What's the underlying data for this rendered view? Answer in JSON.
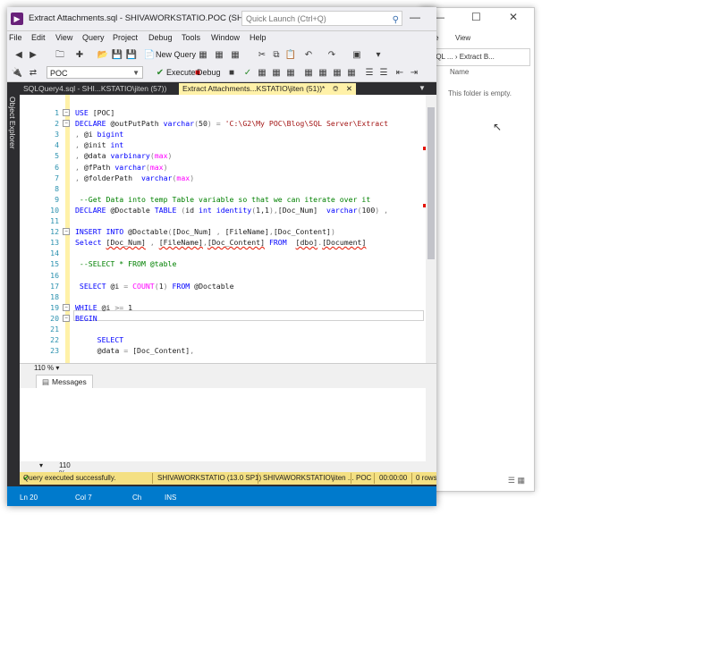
{
  "ssms": {
    "window_title": "Extract Attachments.sql - SHIVAWORKSTATIO.POC (SHIVAWORK...",
    "quick_launch_placeholder": "Quick Launch (Ctrl+Q)",
    "menu": [
      "File",
      "Edit",
      "View",
      "Query",
      "Project",
      "Debug",
      "Tools",
      "Window",
      "Help"
    ],
    "toolbar": {
      "new_query": "New Query",
      "database": "POC",
      "execute": "Execute",
      "debug": "Debug"
    },
    "tabs": {
      "inactive": "SQLQuery4.sql - SHI...KSTATIO\\jiten (57))",
      "active": "Extract Attachments...KSTATIO\\jiten (51))*"
    },
    "object_explorer": "Object Explorer",
    "editor_lines": [
      {
        "n": "1",
        "tokens": [
          [
            "kw",
            "USE "
          ],
          [
            "id",
            "[POC]"
          ]
        ],
        "fold": true
      },
      {
        "n": "2",
        "tokens": [
          [
            "kw",
            "DECLARE "
          ],
          [
            "id",
            "@outPutPath "
          ],
          [
            "kw",
            "varchar"
          ],
          [
            "gr",
            "("
          ],
          [
            "id",
            "50"
          ],
          [
            "gr",
            ") = "
          ],
          [
            "str",
            "'C:\\G2\\My POC\\Blog\\SQL Server\\Extract"
          ]
        ],
        "fold": true
      },
      {
        "n": "3",
        "tokens": [
          [
            "gr",
            ", "
          ],
          [
            "id",
            "@i "
          ],
          [
            "kw",
            "bigint"
          ]
        ]
      },
      {
        "n": "4",
        "tokens": [
          [
            "gr",
            ", "
          ],
          [
            "id",
            "@init "
          ],
          [
            "kw",
            "int"
          ]
        ]
      },
      {
        "n": "5",
        "tokens": [
          [
            "gr",
            ", "
          ],
          [
            "id",
            "@data "
          ],
          [
            "kw",
            "varbinary"
          ],
          [
            "gr",
            "("
          ],
          [
            "fn",
            "max"
          ],
          [
            "gr",
            ")"
          ]
        ]
      },
      {
        "n": "6",
        "tokens": [
          [
            "gr",
            ", "
          ],
          [
            "id",
            "@fPath "
          ],
          [
            "kw",
            "varchar"
          ],
          [
            "gr",
            "("
          ],
          [
            "fn",
            "max"
          ],
          [
            "gr",
            ")"
          ]
        ]
      },
      {
        "n": "7",
        "tokens": [
          [
            "gr",
            ", "
          ],
          [
            "id",
            "@folderPath  "
          ],
          [
            "kw",
            "varchar"
          ],
          [
            "gr",
            "("
          ],
          [
            "fn",
            "max"
          ],
          [
            "gr",
            ")"
          ]
        ]
      },
      {
        "n": "8",
        "tokens": []
      },
      {
        "n": "9",
        "tokens": [
          [
            "cm",
            " --Get Data into temp Table variable so that we can iterate over it"
          ]
        ]
      },
      {
        "n": "10",
        "tokens": [
          [
            "kw",
            "DECLARE "
          ],
          [
            "id",
            "@Doctable "
          ],
          [
            "kw",
            "TABLE "
          ],
          [
            "gr",
            "("
          ],
          [
            "id",
            "id "
          ],
          [
            "kw",
            "int identity"
          ],
          [
            "gr",
            "("
          ],
          [
            "id",
            "1,1"
          ],
          [
            "gr",
            "),"
          ],
          [
            "id",
            "[Doc_Num]  "
          ],
          [
            "kw",
            "varchar"
          ],
          [
            "gr",
            "("
          ],
          [
            "id",
            "100"
          ],
          [
            "gr",
            ") ,"
          ]
        ]
      },
      {
        "n": "11",
        "tokens": []
      },
      {
        "n": "12",
        "tokens": [
          [
            "kw",
            "INSERT INTO "
          ],
          [
            "id",
            "@Doctable"
          ],
          [
            "gr",
            "("
          ],
          [
            "id",
            "[Doc_Num] "
          ],
          [
            "gr",
            ", "
          ],
          [
            "id",
            "[FileName]"
          ],
          [
            "gr",
            ","
          ],
          [
            "id",
            "[Doc_Content]"
          ],
          [
            "gr",
            ")"
          ]
        ],
        "fold": true
      },
      {
        "n": "13",
        "tokens": [
          [
            "kw",
            "Select "
          ],
          [
            "sqid",
            "[Doc_Num]"
          ],
          [
            "gr",
            " , "
          ],
          [
            "sqid",
            "[FileName]"
          ],
          [
            "gr",
            ","
          ],
          [
            "sqid",
            "[Doc_Content]"
          ],
          [
            "kw",
            " FROM  "
          ],
          [
            "sqid",
            "[dbo]"
          ],
          [
            "gr",
            "."
          ],
          [
            "sqid",
            "[Document]"
          ]
        ]
      },
      {
        "n": "14",
        "tokens": []
      },
      {
        "n": "15",
        "tokens": [
          [
            "cm",
            " --SELECT * FROM @table"
          ]
        ]
      },
      {
        "n": "16",
        "tokens": []
      },
      {
        "n": "17",
        "tokens": [
          [
            "kw",
            " SELECT "
          ],
          [
            "id",
            "@i "
          ],
          [
            "gr",
            "= "
          ],
          [
            "fn",
            "COUNT"
          ],
          [
            "gr",
            "("
          ],
          [
            "id",
            "1"
          ],
          [
            "gr",
            ") "
          ],
          [
            "kw",
            "FROM "
          ],
          [
            "id",
            "@Doctable"
          ]
        ]
      },
      {
        "n": "18",
        "tokens": []
      },
      {
        "n": "19",
        "tokens": [
          [
            "kw",
            "WHILE "
          ],
          [
            "id",
            "@i "
          ],
          [
            "gr",
            ">= "
          ],
          [
            "id",
            "1"
          ]
        ],
        "fold": true
      },
      {
        "n": "20",
        "tokens": [
          [
            "kw",
            "BEGIN"
          ]
        ],
        "fold": true
      },
      {
        "n": "21",
        "tokens": []
      },
      {
        "n": "22",
        "tokens": [
          [
            "kw",
            "     SELECT"
          ]
        ]
      },
      {
        "n": "23",
        "tokens": [
          [
            "id",
            "     @data "
          ],
          [
            "gr",
            "= "
          ],
          [
            "id",
            "[Doc_Content]"
          ],
          [
            "gr",
            ","
          ]
        ]
      }
    ],
    "zoom": "110 %",
    "messages_tab": "Messages",
    "results_zoom": "110 %",
    "query_status": {
      "message": "Query executed successfully.",
      "server": "SHIVAWORKSTATIO (13.0 SP1)",
      "user": "SHIVAWORKSTATIO\\jiten ...",
      "database": "POC",
      "elapsed": "00:00:00",
      "rows": "0 rows"
    },
    "statusbar": {
      "ln": "Ln 20",
      "col": "Col 7",
      "ch": "Ch",
      "mode": "INS"
    }
  },
  "explorer": {
    "ribbon": [
      "are",
      "View"
    ],
    "address": "SQL ... › Extract B...",
    "column_name": "Name",
    "empty_text": "This folder is empty."
  }
}
